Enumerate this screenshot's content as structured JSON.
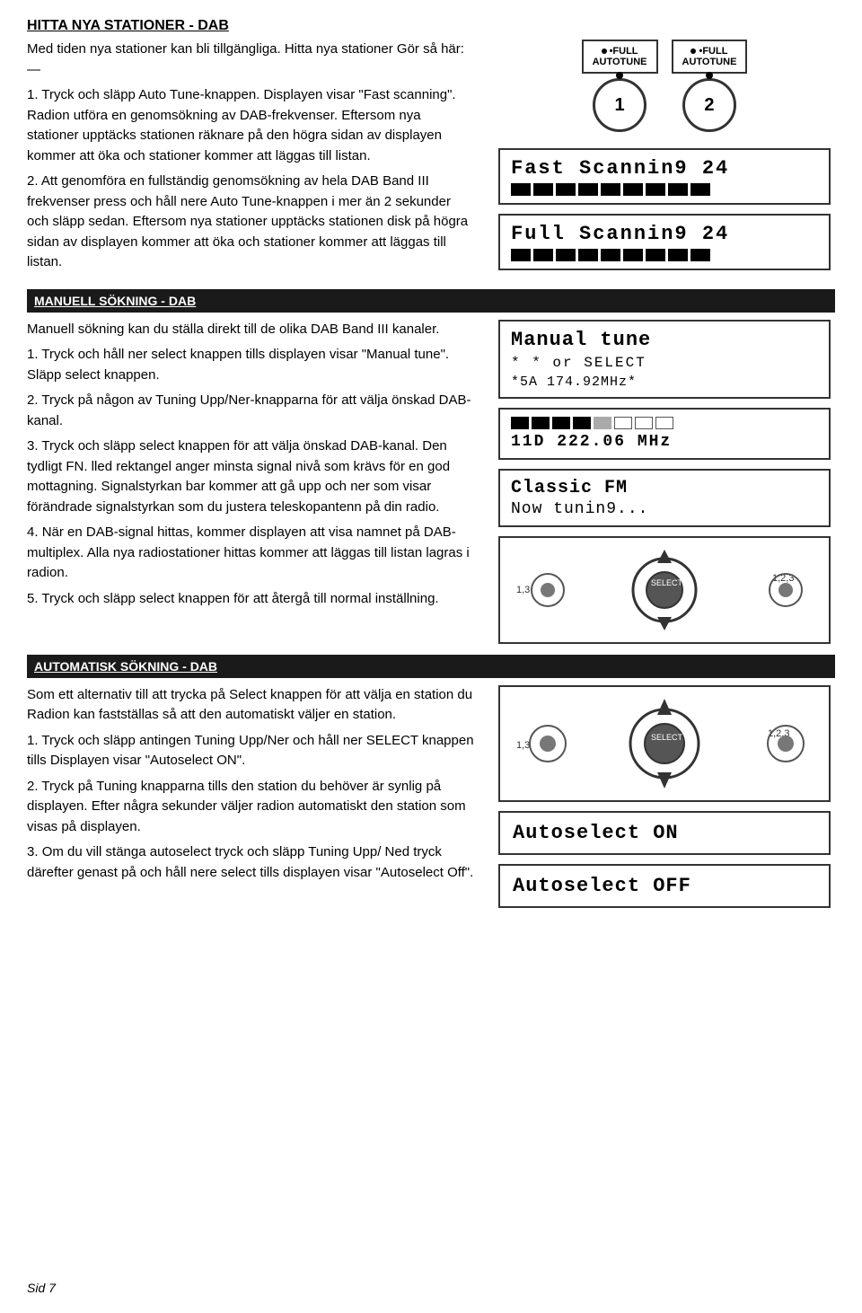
{
  "page": {
    "footer": "Sid 7"
  },
  "sections": {
    "hitta": {
      "title": "HITTA NYA STATIONER - DAB",
      "intro": "Med tiden nya stationer kan bli tillgängliga. Hitta nya stationer Gör så här: —",
      "step1_label": "1.",
      "step1": "Tryck och släpp Auto Tune-knappen. Displayen visar \"Fast scanning\". Radion utföra en genomsökning av DAB-frekvenser. Eftersom nya stationer upptäcks stationen räknare på den högra sidan av displayen kommer att öka och stationer kommer att läggas till listan.",
      "step2_num": "2.",
      "step2": "Att genomföra en fullständig genomsökning av hela DAB Band III frekvenser press och håll nere Auto Tune-knappen i mer än 2 sekunder och släpp sedan. Eftersom nya stationer upptäcks stationen disk på högra sidan av displayen kommer att öka och stationer kommer att läggas till listan.",
      "autotune1_label": "•FULL",
      "autotune1_sub": "AUTOTUNE",
      "autotune2_label": "•FULL",
      "autotune2_sub": "AUTOTUNE",
      "circle1_num": "1",
      "circle2_num": "2",
      "fast_scanning_line": "Fast Scannin9 24",
      "fast_blocks_filled": 9,
      "fast_blocks_total": 9,
      "full_scanning_line": "Full Scannin9 24",
      "full_blocks_filled": 9,
      "full_blocks_total": 9
    },
    "manuell": {
      "title": "MANUELL SÖKNING - DAB",
      "intro": "Manuell sökning kan du ställa direkt till de olika DAB Band III kanaler.",
      "step1_num": "1.",
      "step1": "Tryck och håll ner  select knappen tills displayen visar \"Manual tune\". Släpp select knappen.",
      "step2_num": "2.",
      "step2": "Tryck på någon av Tuning Upp/Ner-knapparna för att välja önskad DAB-kanal.",
      "step3_num": "3.",
      "step3": "Tryck och släpp select knappen för att välja önskad DAB-kanal. Den tydligt FN. lled rektangel anger minsta signal nivå som krävs för en god mottagning. Signalstyrkan bar kommer att gå upp och ner som visar förändrade signalstyrkan som du justera teleskopantenn på din radio.",
      "step4_num": "4.",
      "step4": "När en DAB-signal hittas, kommer displayen att visa namnet på DAB-multiplex. Alla nya radiostationer hittas kommer att läggas till listan lagras i radion.",
      "step5_num": "5.",
      "step5": "Tryck och släpp select knappen för att återgå till normal inställning.",
      "display_mt_line1": "Manual tune",
      "display_mt_line2": "* * or SELECT",
      "display_mt_line3": "*5A   174.92MHz*",
      "display_ch_line": "11D  222.06 MHz",
      "display_classic_line1": "Classic FM",
      "display_classic_line2": "Now tunin9..."
    },
    "automatisk": {
      "title": "AUTOMATISK SÖKNING - DAB",
      "intro": "Som ett alternativ till att trycka på Select knappen för att välja en station du Radion kan fastställas så att den automatiskt väljer en station.",
      "step1_num": "1.",
      "step1": "Tryck och släpp antingen Tuning Upp/Ner  och håll ner SELECT knappen  tills Displayen visar \"Autoselect ON\".",
      "step2_num": "2.",
      "step2": "Tryck på Tuning knapparna tills den station du behöver är synlig på displayen. Efter några sekunder väljer radion automatiskt  den station som visas på displayen.",
      "step3_num": "3.",
      "step3": "Om du vill stänga autoselect tryck och släpp Tuning Upp/ Ned tryck därefter genast på och håll nere select tills displayen visar \"Autoselect Off\".",
      "autoselect_on": "Autoselect ON",
      "autoselect_off": "Autoselect OFF"
    }
  }
}
